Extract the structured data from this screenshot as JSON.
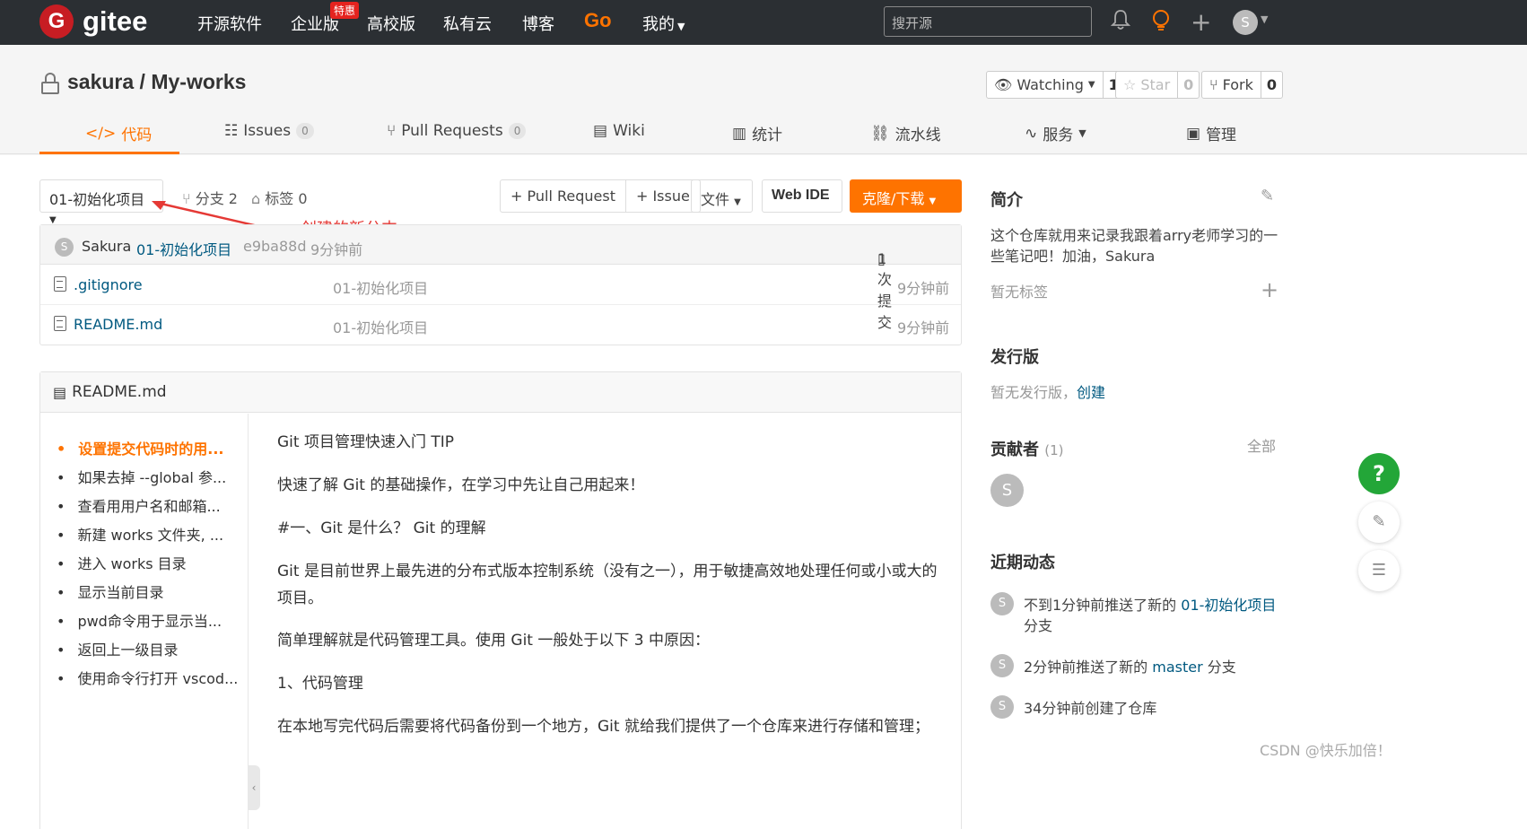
{
  "topnav": {
    "logo_letter": "G",
    "logo_text": "gitee",
    "items": [
      "开源软件",
      "企业版",
      "高校版",
      "私有云",
      "博客",
      "Go",
      "我的"
    ],
    "badge": "特惠",
    "search_placeholder": "搜开源",
    "avatar_letter": "S"
  },
  "repo": {
    "title": "sakura / My-works",
    "watching_label": "Watching",
    "watching_count": "1",
    "star_label": "Star",
    "star_count": "0",
    "fork_label": "Fork",
    "fork_count": "0"
  },
  "tabs": [
    {
      "label": "代码"
    },
    {
      "label": "Issues",
      "count": "0"
    },
    {
      "label": "Pull Requests",
      "count": "0"
    },
    {
      "label": "Wiki"
    },
    {
      "label": "统计"
    },
    {
      "label": "流水线"
    },
    {
      "label": "服务"
    },
    {
      "label": "管理"
    }
  ],
  "toolbar": {
    "branch": "01-初始化项目",
    "branches": "分支 2",
    "tags": "标签 0",
    "pull_request": "+ Pull Request",
    "issue": "+ Issue",
    "file": "文件",
    "webide": "Web IDE",
    "clone": "克隆/下载"
  },
  "annotation": "创建的新分支",
  "commit": {
    "avatar": "S",
    "author": "Sakura",
    "message": "01-初始化项目",
    "hash": "e9ba88d",
    "time": "9分钟前",
    "count": "1 次提交"
  },
  "files": [
    {
      "name": ".gitignore",
      "message": "01-初始化项目",
      "time": "9分钟前"
    },
    {
      "name": "README.md",
      "message": "01-初始化项目",
      "time": "9分钟前"
    }
  ],
  "readme": {
    "title": "README.md",
    "toc": [
      "设置提交代码时的用...",
      "如果去掉 --global 参...",
      "查看用用户名和邮箱...",
      "新建 works 文件夹, ...",
      "进入 works 目录",
      "显示当前目录",
      "pwd命令用于显示当...",
      "返回上一级目录",
      "使用命令行打开 vscod..."
    ],
    "paragraphs": [
      "Git 项目管理快速入门 TIP",
      "快速了解 Git 的基础操作，在学习中先让自己用起来！",
      "#一、Git 是什么？ Git 的理解",
      "Git 是目前世界上最先进的分布式版本控制系统（没有之一），用于敏捷高效地处理任何或小或大的项目。",
      "简单理解就是代码管理工具。使用 Git 一般处于以下 3 中原因：",
      "1、代码管理",
      "在本地写完代码后需要将代码备份到一个地方，Git 就给我们提供了一个仓库来进行存储和管理；"
    ]
  },
  "sidebar": {
    "intro_title": "简介",
    "intro_text": "这个仓库就用来记录我跟着arry老师学习的一些笔记吧！加油，Sakura",
    "no_tags": "暂无标签",
    "release_title": "发行版",
    "release_text": "暂无发行版，",
    "release_create": "创建",
    "contrib_title": "贡献者",
    "contrib_count": "(1)",
    "contrib_all": "全部",
    "contrib_avatar": "S",
    "activity_title": "近期动态",
    "activities": [
      {
        "avatar": "S",
        "prefix": "不到1分钟前推送了新的 ",
        "link": "01-初始化项目",
        "suffix": " 分支"
      },
      {
        "avatar": "S",
        "prefix": "2分钟前推送了新的 ",
        "link": "master",
        "suffix": " 分支"
      },
      {
        "avatar": "S",
        "prefix": "34分钟前创建了仓库",
        "link": "",
        "suffix": ""
      }
    ]
  },
  "watermark": "CSDN @快乐加倍！",
  "help_label": "?"
}
